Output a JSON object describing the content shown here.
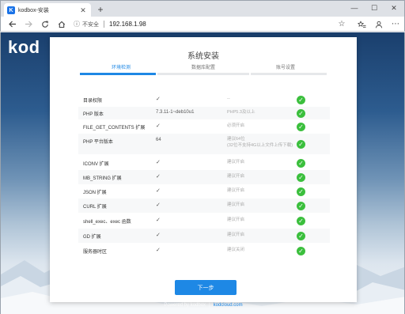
{
  "browser": {
    "tab_title": "kodbox-安装",
    "favicon_letter": "K",
    "tab_close": "✕",
    "new_tab": "+",
    "address": {
      "security_label": "不安全",
      "url": "192.168.1.98"
    },
    "window_controls": [
      "—",
      "☐",
      "✕"
    ]
  },
  "page": {
    "brand": "kod",
    "title": "系统安装",
    "steps": [
      {
        "label": "环境检测",
        "active": true
      },
      {
        "label": "数据库配置",
        "active": false
      },
      {
        "label": "账号设置",
        "active": false
      }
    ],
    "checks": [
      {
        "name": "目录权限",
        "value": "✓",
        "requirement": "--",
        "status": "ok"
      },
      {
        "name": "PHP 版本",
        "value": "7.3.11-1~deb10u1",
        "requirement": "PHP5.3及以上",
        "status": "ok"
      },
      {
        "name": "FILE_GET_CONTENTS 扩展",
        "value": "✓",
        "requirement": "必须开启",
        "status": "ok"
      },
      {
        "name": "PHP 平台版本",
        "value": "64",
        "requirement": "建议64位",
        "requirement_2": "(32位不支持4G以上文件上传下载)",
        "status": "ok"
      },
      {
        "name": "ICONV 扩展",
        "value": "✓",
        "requirement": "建议开启",
        "status": "ok"
      },
      {
        "name": "MB_STRING 扩展",
        "value": "✓",
        "requirement": "建议开启",
        "status": "ok"
      },
      {
        "name": "JSON 扩展",
        "value": "✓",
        "requirement": "建议开启",
        "status": "ok"
      },
      {
        "name": "CURL 扩展",
        "value": "✓",
        "requirement": "建议开启",
        "status": "ok"
      },
      {
        "name": "shell_exec、exec 函数",
        "value": "✓",
        "requirement": "建议开启",
        "status": "ok"
      },
      {
        "name": "GD 扩展",
        "value": "✓",
        "requirement": "建议开启",
        "status": "ok"
      },
      {
        "name": "服务器时区",
        "value": "✓",
        "requirement": "建议关闭",
        "status": "ok"
      }
    ],
    "next_button": "下一步",
    "footer": {
      "left": "Powered by kodbox",
      "right": "kodcloud.com"
    }
  },
  "colors": {
    "accent": "#1e88e5",
    "ok": "#3bbf3d"
  }
}
